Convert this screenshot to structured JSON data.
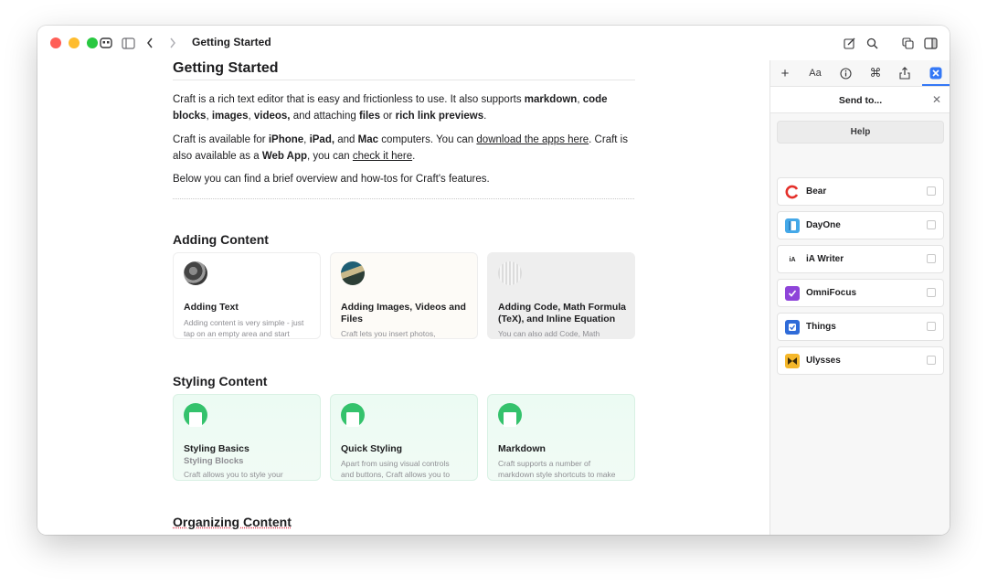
{
  "window": {
    "title": "Getting Started"
  },
  "colors": {
    "close": "#ff5f57",
    "minimize": "#febc2e",
    "zoom": "#28c840",
    "accent": "#3478f6",
    "card_green": "#34c26c"
  },
  "toolbar": {
    "icons": [
      "craft-logo-icon",
      "sidebar-toggle-icon",
      "back-chevron-icon",
      "forward-chevron-icon",
      "compose-icon",
      "search-icon",
      "duplicate-window-icon",
      "right-panel-toggle-icon"
    ]
  },
  "document": {
    "title": "Getting Started",
    "intro": {
      "p1": [
        {
          "t": "Craft is a rich text editor that is easy and frictionless to use. It also supports ",
          "s": ""
        },
        {
          "t": "markdown",
          "s": "b"
        },
        {
          "t": ", ",
          "s": ""
        },
        {
          "t": "code blocks",
          "s": "b"
        },
        {
          "t": ", ",
          "s": ""
        },
        {
          "t": "images",
          "s": "b"
        },
        {
          "t": ", ",
          "s": ""
        },
        {
          "t": "videos,",
          "s": "b"
        },
        {
          "t": " and attaching ",
          "s": ""
        },
        {
          "t": "files",
          "s": "b"
        },
        {
          "t": " or ",
          "s": ""
        },
        {
          "t": "rich link previews",
          "s": "b"
        },
        {
          "t": ".",
          "s": ""
        }
      ],
      "p2": [
        {
          "t": "Craft is available for ",
          "s": ""
        },
        {
          "t": "iPhone",
          "s": "b"
        },
        {
          "t": ", ",
          "s": ""
        },
        {
          "t": "iPad,",
          "s": "b"
        },
        {
          "t": " and ",
          "s": ""
        },
        {
          "t": "Mac",
          "s": "b"
        },
        {
          "t": " computers. You can ",
          "s": ""
        },
        {
          "t": "download the apps here",
          "s": "u"
        },
        {
          "t": ". Craft is also available as a ",
          "s": ""
        },
        {
          "t": "Web App",
          "s": "b"
        },
        {
          "t": ", you can ",
          "s": ""
        },
        {
          "t": "check it here",
          "s": "u"
        },
        {
          "t": ".",
          "s": ""
        }
      ],
      "p3": "Below you can find a brief overview and how-tos for Craft's features."
    },
    "sections": [
      {
        "heading": "Adding Content",
        "cards": [
          {
            "title": "Adding Text",
            "subtitle": "",
            "description": "Adding content is very simple - just tap on an empty area and start typing. You can also drag"
          },
          {
            "title": "Adding Images, Videos and Files",
            "subtitle": "",
            "description": "Craft lets you insert photos, videos, and any files from your"
          },
          {
            "title": "Adding Code, Math Formula (TeX), and Inline Equation",
            "subtitle": "",
            "description": "You can also add Code, Math Formula (TeX), plaintext"
          }
        ]
      },
      {
        "heading": "Styling Content",
        "cards": [
          {
            "title": "Styling Basics",
            "subtitle": "Styling Blocks",
            "description": "Craft allows you to style your content in a beautiful and"
          },
          {
            "title": "Quick Styling",
            "subtitle": "",
            "description": "Apart from using visual controls and buttons, Craft allows you to style your content right from the"
          },
          {
            "title": "Markdown",
            "subtitle": "",
            "description": "Craft supports a number of markdown style shortcuts to make editing and writing faster"
          }
        ]
      },
      {
        "heading": "Organizing Content"
      }
    ]
  },
  "panel": {
    "tools": [
      "plus-icon",
      "Aa",
      "info-icon",
      "command-icon",
      "share-icon",
      "send-to-icon"
    ],
    "title": "Send to...",
    "help_label": "Help",
    "apps": [
      {
        "label": "Bear",
        "icon": "bear-app-icon",
        "color": "#e4312b"
      },
      {
        "label": "DayOne",
        "icon": "dayone-app-icon",
        "color": "#44a8e8"
      },
      {
        "label": "iA Writer",
        "icon": "ia-writer-app-icon",
        "color": "#ffffff"
      },
      {
        "label": "OmniFocus",
        "icon": "omnifocus-app-icon",
        "color": "#8e44d9"
      },
      {
        "label": "Things",
        "icon": "things-app-icon",
        "color": "#2f6bd8"
      },
      {
        "label": "Ulysses",
        "icon": "ulysses-app-icon",
        "color": "#f5b72a"
      }
    ]
  }
}
